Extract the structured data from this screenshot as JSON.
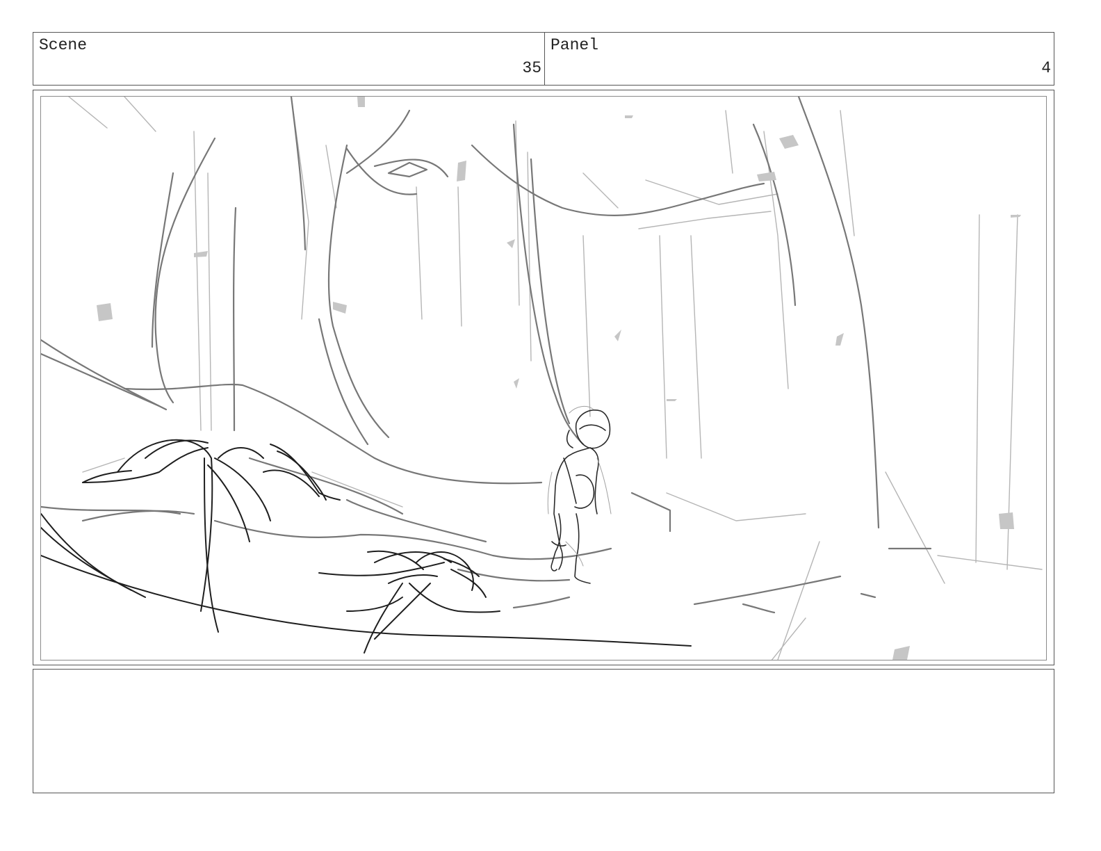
{
  "header": {
    "scene_label": "Scene",
    "scene_number": "35",
    "panel_label": "Panel",
    "panel_number": "4"
  },
  "artwork": {
    "description_icon": "sketch-forest-child-icon",
    "line_color_dark": "#1a1a1a",
    "line_color_mid": "#707070",
    "line_color_light": "#b0b0b0",
    "leaf_color": "#c4c4c4"
  },
  "notes": {
    "text": ""
  }
}
